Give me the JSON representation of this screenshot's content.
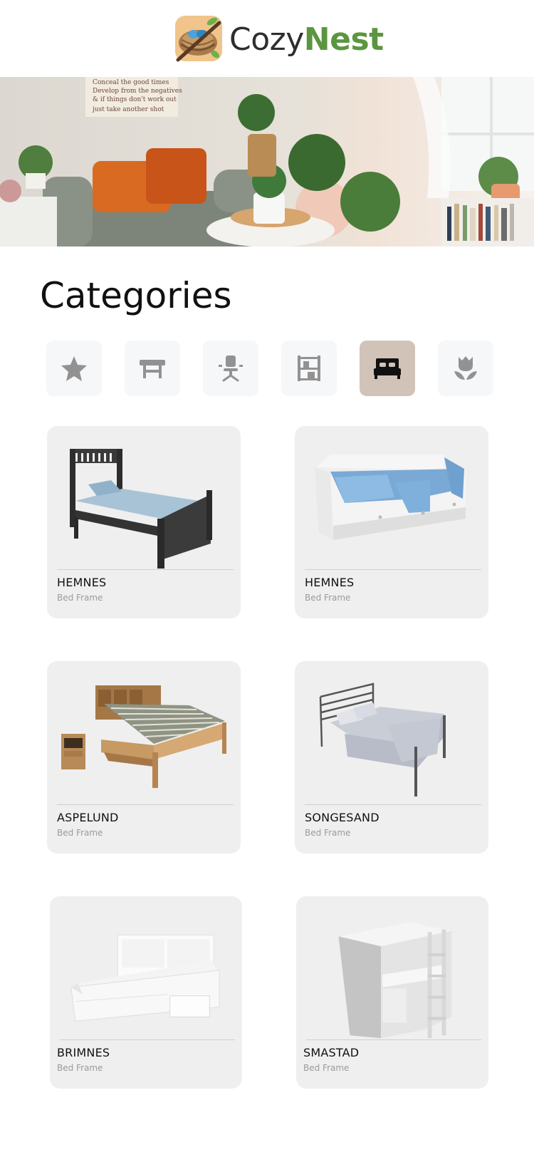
{
  "brand": {
    "part1": "Cozy",
    "part2": "Nest"
  },
  "hero": {
    "sign_lines": [
      "Conceal the good times",
      "Develop from the negatives",
      "& if things don't work out",
      "just take another shot"
    ]
  },
  "categories_title": "Categories",
  "category_icons": [
    "star-icon",
    "table-icon",
    "office-chair-icon",
    "shelf-icon",
    "bed-icon",
    "tulip-icon"
  ],
  "active_category": "bed-icon",
  "colors": {
    "brand_green": "#5b963f",
    "active_category_bg": "#d1c3b7",
    "card_bg": "#efefef"
  },
  "products": [
    {
      "name": "HEMNES",
      "type": "Bed Frame"
    },
    {
      "name": "HEMNES",
      "type": "Bed Frame"
    },
    {
      "name": "ASPELUND",
      "type": "Bed Frame"
    },
    {
      "name": "SONGESAND",
      "type": "Bed Frame"
    },
    {
      "name": "BRIMNES",
      "type": "Bed Frame"
    },
    {
      "name": "SMASTAD",
      "type": "Bed Frame"
    }
  ]
}
